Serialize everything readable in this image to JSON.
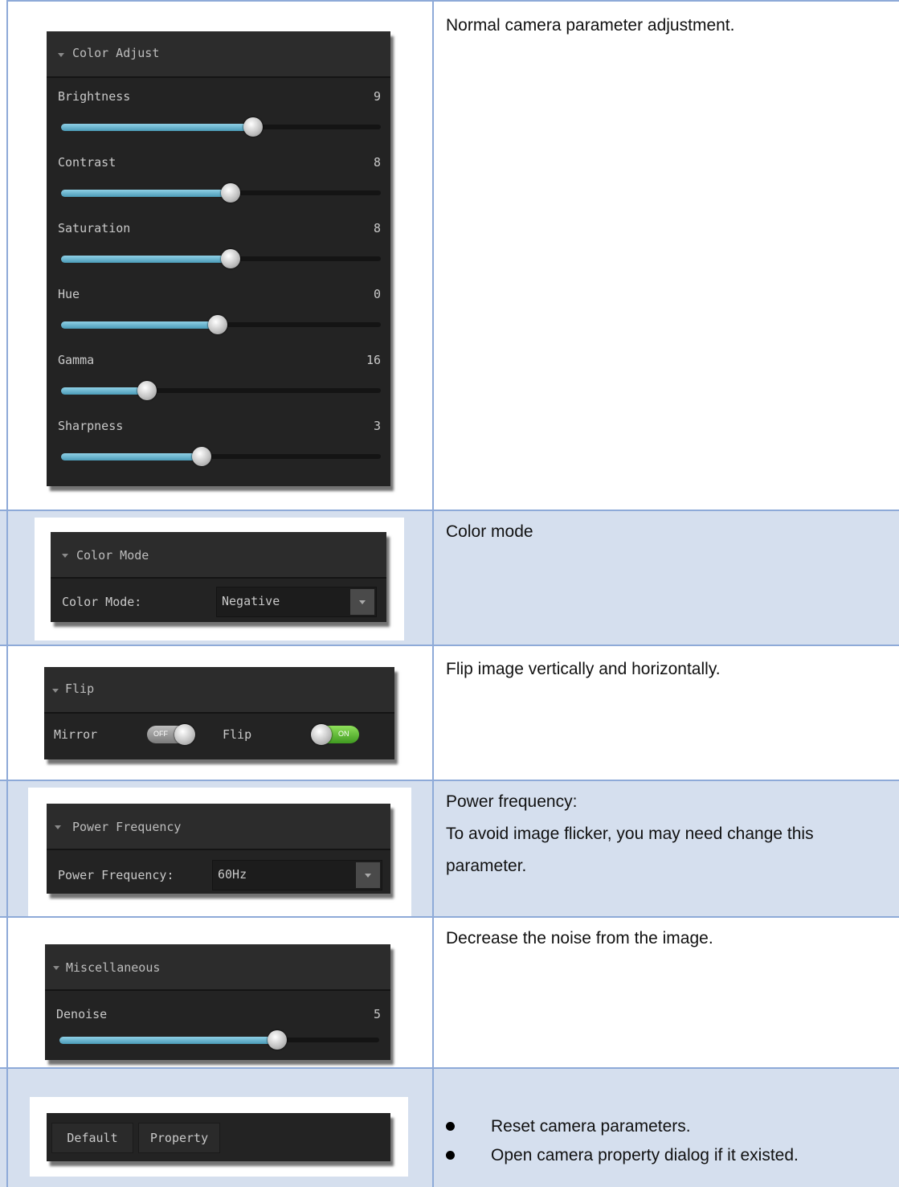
{
  "rows": {
    "color_adjust": {
      "description": "Normal camera parameter adjustment.",
      "panel_title": "Color Adjust",
      "sliders": [
        {
          "label": "Brightness",
          "value": "9",
          "fraction": 0.6
        },
        {
          "label": "Contrast",
          "value": "8",
          "fraction": 0.53
        },
        {
          "label": "Saturation",
          "value": "8",
          "fraction": 0.53
        },
        {
          "label": "Hue",
          "value": "0",
          "fraction": 0.49
        },
        {
          "label": "Gamma",
          "value": "16",
          "fraction": 0.27
        },
        {
          "label": "Sharpness",
          "value": "3",
          "fraction": 0.44
        }
      ]
    },
    "color_mode": {
      "description": "Color mode",
      "panel_title": "Color Mode",
      "field_label": "Color Mode:",
      "selected": "Negative"
    },
    "flip": {
      "description": "Flip image vertically and horizontally.",
      "panel_title": "Flip",
      "mirror_label": "Mirror",
      "mirror_state": "OFF",
      "flip_label": "Flip",
      "flip_state": "ON"
    },
    "power_frequency": {
      "description_line1": "Power frequency:",
      "description_line2": "To avoid image flicker, you may need change this",
      "description_line3": "parameter.",
      "panel_title": "Power Frequency",
      "field_label": "Power Frequency:",
      "selected": "60Hz"
    },
    "miscellaneous": {
      "description": "Decrease the noise from the image.",
      "panel_title": "Miscellaneous",
      "slider": {
        "label": "Denoise",
        "value": "5",
        "fraction": 0.68
      }
    },
    "buttons": {
      "default_label": "Default",
      "property_label": "Property",
      "bullet1": "Reset camera parameters.",
      "bullet2": "Open camera property dialog if it existed."
    }
  }
}
